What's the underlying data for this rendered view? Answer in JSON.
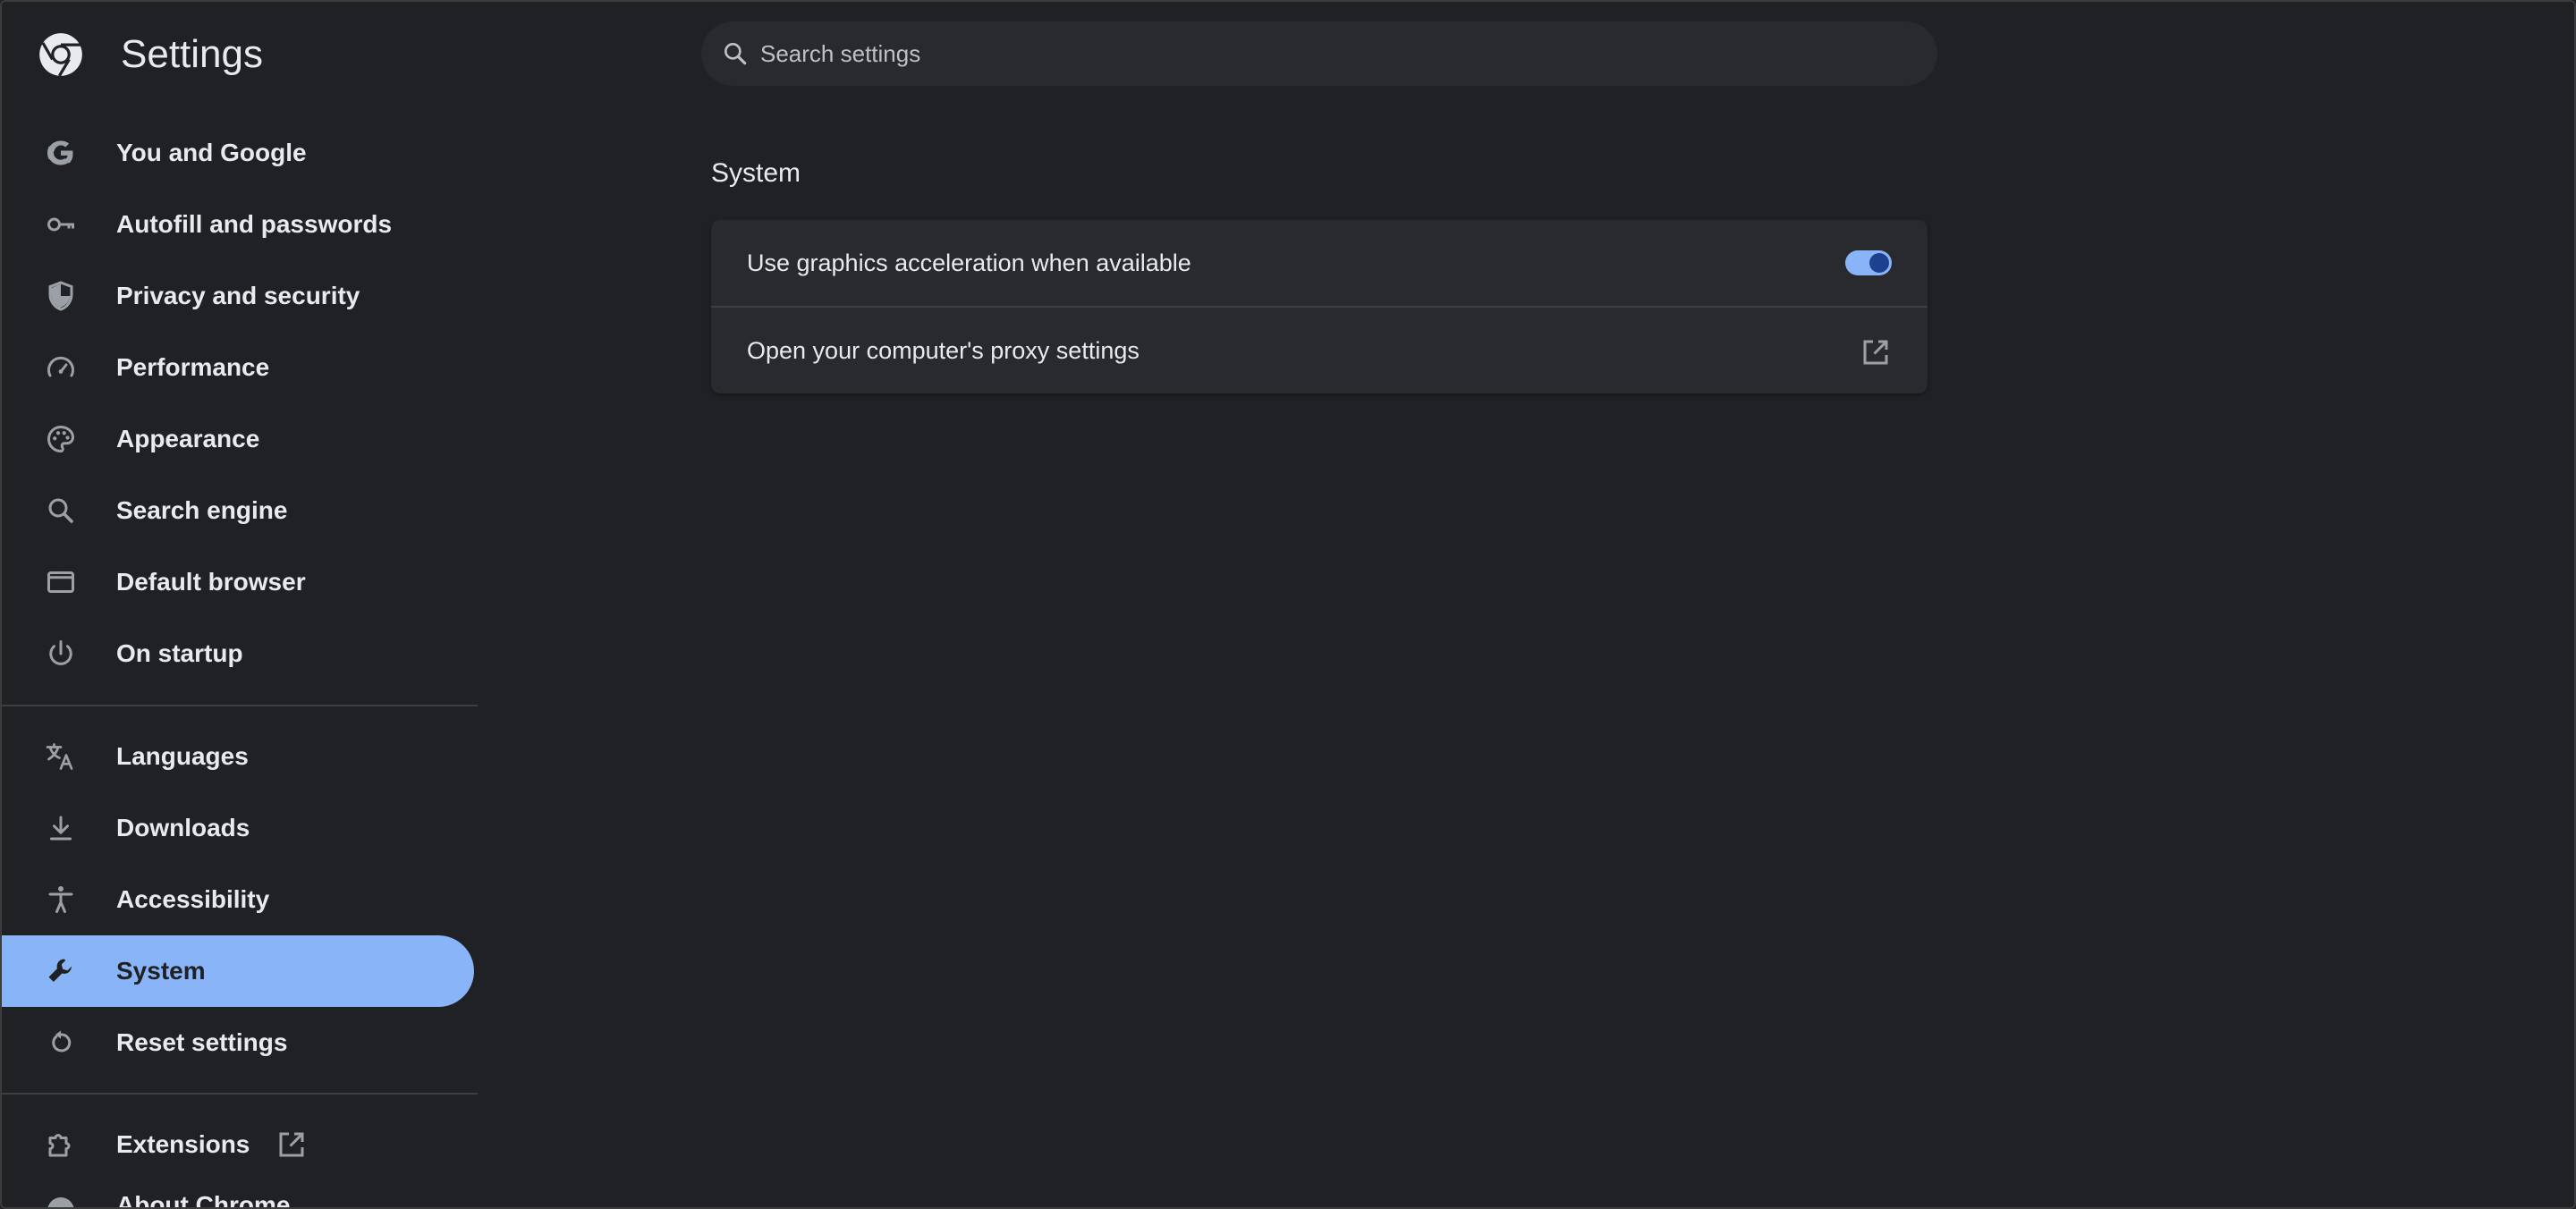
{
  "header": {
    "title": "Settings",
    "search": {
      "placeholder": "Search settings",
      "value": ""
    }
  },
  "sidebar": {
    "items": [
      {
        "label": "You and Google",
        "icon": "google-g-icon"
      },
      {
        "label": "Autofill and passwords",
        "icon": "key-icon"
      },
      {
        "label": "Privacy and security",
        "icon": "shield-icon"
      },
      {
        "label": "Performance",
        "icon": "speedometer-icon"
      },
      {
        "label": "Appearance",
        "icon": "palette-icon"
      },
      {
        "label": "Search engine",
        "icon": "search-icon"
      },
      {
        "label": "Default browser",
        "icon": "browser-window-icon"
      },
      {
        "label": "On startup",
        "icon": "power-icon"
      },
      {
        "label": "Languages",
        "icon": "translate-icon"
      },
      {
        "label": "Downloads",
        "icon": "download-icon"
      },
      {
        "label": "Accessibility",
        "icon": "accessibility-icon"
      },
      {
        "label": "System",
        "icon": "wrench-icon",
        "active": true
      },
      {
        "label": "Reset settings",
        "icon": "reset-icon"
      },
      {
        "label": "Extensions",
        "icon": "puzzle-icon",
        "external": true
      },
      {
        "label": "About Chrome",
        "icon": "chrome-icon",
        "partially_visible": true
      }
    ]
  },
  "main": {
    "section_title": "System",
    "rows": [
      {
        "label": "Use graphics acceleration when available",
        "control": "toggle",
        "checked": true
      },
      {
        "label": "Open your computer's proxy settings",
        "control": "external-link"
      }
    ]
  },
  "colors": {
    "background": "#202124",
    "surface": "#292a2d",
    "accent": "#8ab4f8",
    "text": "#e8eaed",
    "icon": "#9aa0a6",
    "divider": "#3c4043"
  }
}
